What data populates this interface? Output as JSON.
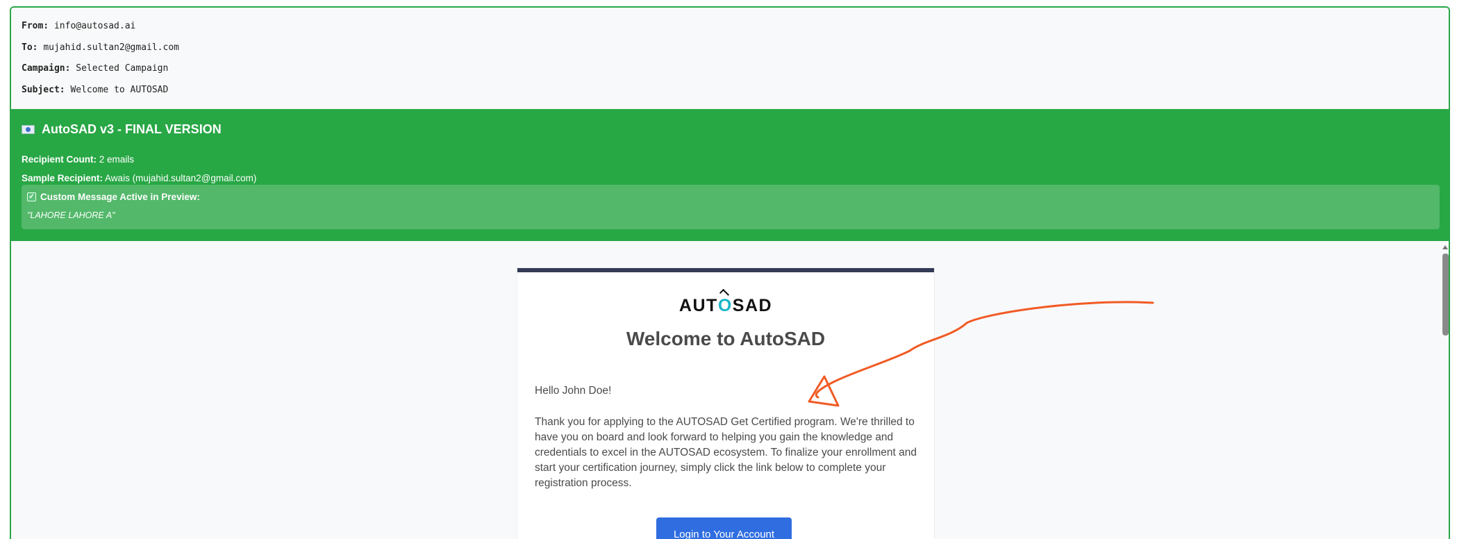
{
  "header": {
    "from_label": "From:",
    "from_value": "info@autosad.ai",
    "to_label": "To:",
    "to_value": "mujahid.sultan2@gmail.com",
    "campaign_label": "Campaign:",
    "campaign_value": "Selected Campaign",
    "subject_label": "Subject:",
    "subject_value": "Welcome to AUTOSAD"
  },
  "banner": {
    "title": "AutoSAD v3 - FINAL VERSION",
    "recipient_count_label": "Recipient Count:",
    "recipient_count_value": "2 emails",
    "sample_recipient_label": "Sample Recipient:",
    "sample_recipient_value": "Awais (mujahid.sultan2@gmail.com)",
    "custom_heading": "Custom Message Active in Preview:",
    "custom_message": "\"LAHORE LAHORE A\""
  },
  "email": {
    "logo_pre": "AUT",
    "logo_o": "O",
    "logo_post": "SAD",
    "heading": "Welcome to AutoSAD",
    "greeting": "Hello John Doe!",
    "body": "Thank you for applying to the AUTOSAD Get Certified program. We're thrilled to have you on board and look forward to helping you gain the knowledge and credentials to excel in the AUTOSAD ecosystem. To finalize your enrollment and start your certification journey, simply click the link below to complete your registration process.",
    "button_label": "Login to Your Account"
  },
  "colors": {
    "banner_green": "#28a745",
    "annotation_orange": "#f15a24",
    "button_blue": "#2f6de1"
  },
  "icons": [
    "flag-icon",
    "checkbox-icon",
    "scroll-up-icon"
  ]
}
